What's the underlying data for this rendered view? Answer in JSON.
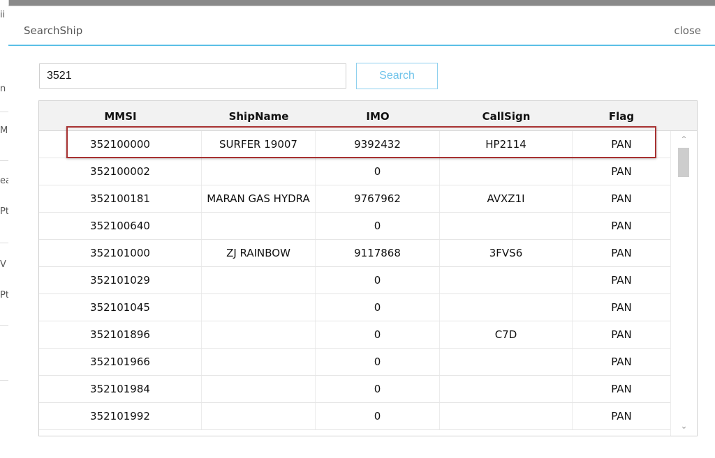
{
  "background": {
    "fragments": [
      "ii",
      "n",
      "M",
      "ea",
      "Pt",
      "V",
      "Pt"
    ]
  },
  "dialog": {
    "title": "SearchShip",
    "close_label": "close",
    "accent_color": "#5bc0e6",
    "highlight_color": "#a83232"
  },
  "search": {
    "value": "3521",
    "button_label": "Search"
  },
  "table": {
    "headers": {
      "mmsi": "MMSI",
      "ship_name": "ShipName",
      "imo": "IMO",
      "call_sign": "CallSign",
      "flag": "Flag"
    },
    "rows": [
      {
        "mmsi": "352100000",
        "ship_name": "SURFER 19007",
        "imo": "9392432",
        "call_sign": "HP2114",
        "flag": "PAN"
      },
      {
        "mmsi": "352100002",
        "ship_name": "",
        "imo": "0",
        "call_sign": "",
        "flag": "PAN"
      },
      {
        "mmsi": "352100181",
        "ship_name": "MARAN GAS HYDRA",
        "imo": "9767962",
        "call_sign": "AVXZ1I",
        "flag": "PAN"
      },
      {
        "mmsi": "352100640",
        "ship_name": "",
        "imo": "0",
        "call_sign": "",
        "flag": "PAN"
      },
      {
        "mmsi": "352101000",
        "ship_name": "ZJ RAINBOW",
        "imo": "9117868",
        "call_sign": "3FVS6",
        "flag": "PAN"
      },
      {
        "mmsi": "352101029",
        "ship_name": "",
        "imo": "0",
        "call_sign": "",
        "flag": "PAN"
      },
      {
        "mmsi": "352101045",
        "ship_name": "",
        "imo": "0",
        "call_sign": "",
        "flag": "PAN"
      },
      {
        "mmsi": "352101896",
        "ship_name": "",
        "imo": "0",
        "call_sign": "C7D",
        "flag": "PAN"
      },
      {
        "mmsi": "352101966",
        "ship_name": "",
        "imo": "0",
        "call_sign": "",
        "flag": "PAN"
      },
      {
        "mmsi": "352101984",
        "ship_name": "",
        "imo": "0",
        "call_sign": "",
        "flag": "PAN"
      },
      {
        "mmsi": "352101992",
        "ship_name": "",
        "imo": "0",
        "call_sign": "",
        "flag": "PAN"
      }
    ],
    "highlighted_row": 0
  },
  "scrollbar": {
    "up_icon": "chevron-up-icon",
    "down_icon": "chevron-down-icon"
  }
}
